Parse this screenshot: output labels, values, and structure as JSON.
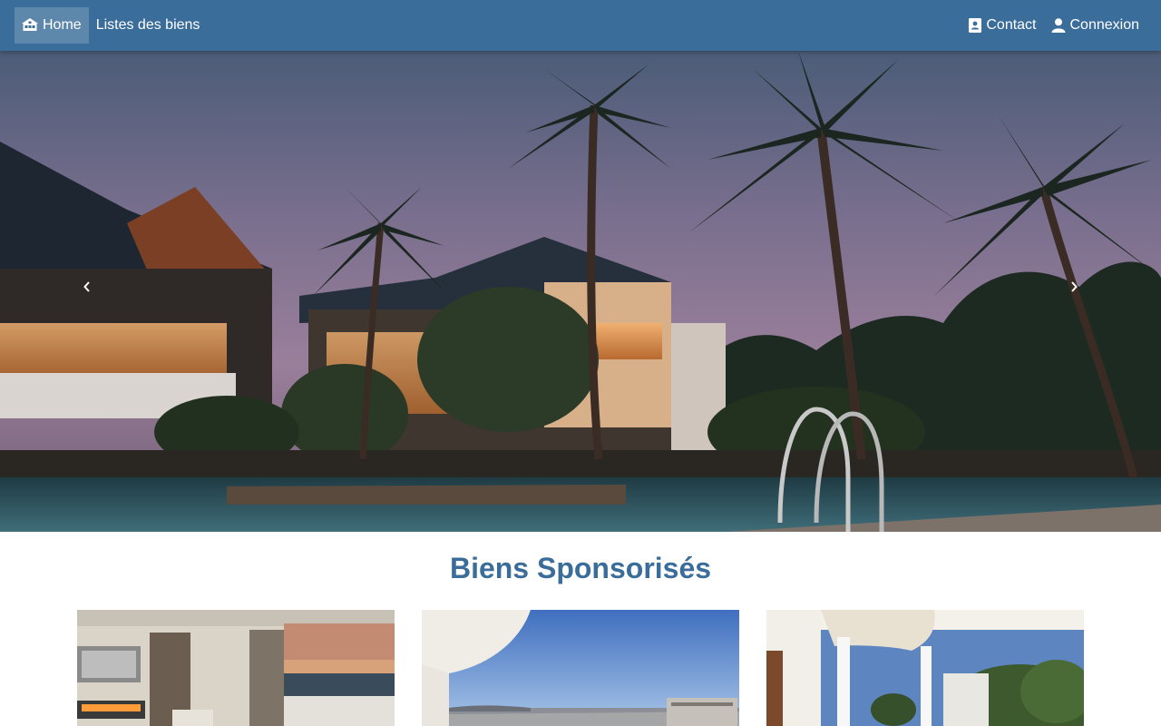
{
  "nav": {
    "left": [
      {
        "label": "Home",
        "icon": "home-group-icon",
        "active": true
      },
      {
        "label": "Listes des biens",
        "active": false
      }
    ],
    "right": [
      {
        "label": "Contact",
        "icon": "address-book-icon"
      },
      {
        "label": "Connexion",
        "icon": "user-icon"
      }
    ]
  },
  "hero": {
    "image": "resort-palm-trees-pool-dusk-photo",
    "prev_icon": "chevron-left-icon",
    "next_icon": "chevron-right-icon"
  },
  "sponsored": {
    "title": "Biens Sponsorisés",
    "cards": [
      {
        "image": "living-room-sea-view-photo"
      },
      {
        "image": "balcony-city-view-photo"
      },
      {
        "image": "white-terrace-garden-photo"
      }
    ]
  },
  "colors": {
    "navbar": "#3b6d9a",
    "title": "#3b6d9a",
    "background": "#ffffff"
  }
}
